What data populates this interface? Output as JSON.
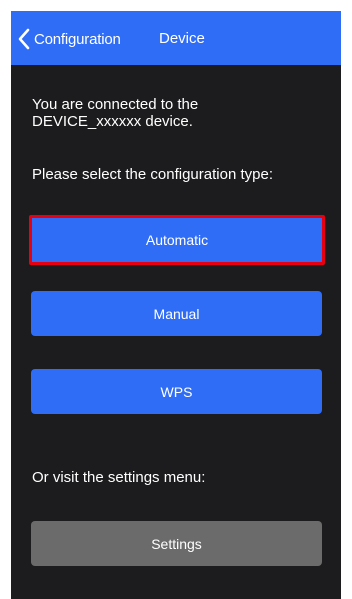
{
  "nav": {
    "back_label": "Configuration",
    "title": "Device",
    "back_icon": "chevron-left-icon"
  },
  "content": {
    "intro_line1": "You are connected to the",
    "intro_line2": "DEVICE_xxxxxx device.",
    "select_prompt": "Please select the configuration type:",
    "settings_prompt": "Or visit the settings menu:"
  },
  "buttons": {
    "automatic": "Automatic",
    "manual": "Manual",
    "wps": "WPS",
    "settings": "Settings"
  },
  "colors": {
    "accent": "#2f6df6",
    "background": "#1c1c1e",
    "highlight_border": "#e60012",
    "secondary_button": "#6b6b6b"
  }
}
